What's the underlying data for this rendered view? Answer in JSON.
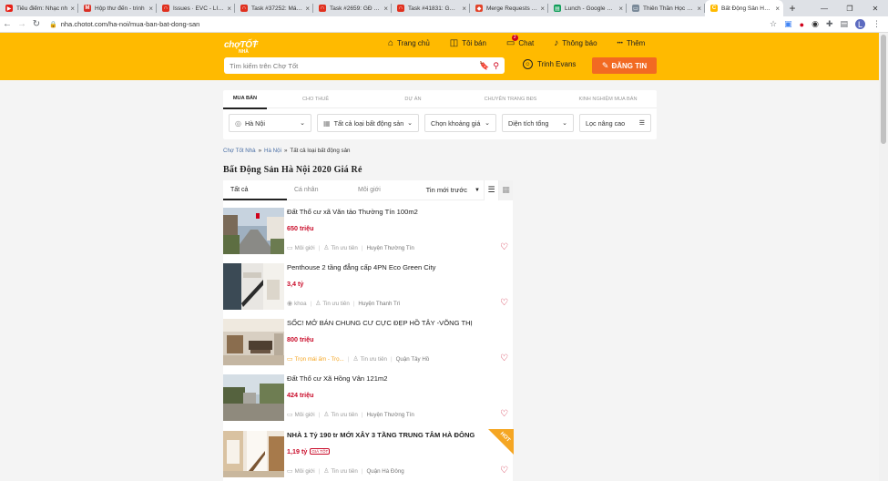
{
  "browser": {
    "tabs": [
      {
        "title": "Tiêu điểm: Nhạc nh",
        "icon_color": "#e62117",
        "icon": "youtube-icon"
      },
      {
        "title": "Hộp thư đến - trinh",
        "icon_color": "#d93025",
        "icon": "gmail-icon"
      },
      {
        "title": "Issues · EVC - LIFET",
        "icon_color": "#e0301e",
        "icon": "task-icon"
      },
      {
        "title": "Task #37252: Mái b",
        "icon_color": "#e0301e",
        "icon": "task-icon"
      },
      {
        "title": "Task #2659: GĐ - H",
        "icon_color": "#e0301e",
        "icon": "task-icon"
      },
      {
        "title": "Task #41831: GĐ - L",
        "icon_color": "#e0301e",
        "icon": "task-icon"
      },
      {
        "title": "Merge Requests · E",
        "icon_color": "#e24329",
        "icon": "gitlab-icon"
      },
      {
        "title": "Lunch - Google She",
        "icon_color": "#0f9d58",
        "icon": "sheets-icon"
      },
      {
        "title": "Thiên Thần Học Việ",
        "icon_color": "#7a8a99",
        "icon": "page-icon"
      },
      {
        "title": "Bất Động Sản Hà N",
        "icon_color": "#ffba00",
        "icon": "chotot-icon",
        "active": true
      }
    ],
    "url": "nha.chotot.com/ha-noi/mua-ban-bat-dong-san",
    "profile_initial": "L"
  },
  "header": {
    "logo_line1": "chợTỐT",
    "logo_line2": "NHÀ",
    "nav": [
      {
        "label": "Trang chủ",
        "icon": "home-icon"
      },
      {
        "label": "Tôi bán",
        "icon": "bag-icon"
      },
      {
        "label": "Chat",
        "icon": "chat-icon",
        "badge": "2"
      },
      {
        "label": "Thông báo",
        "icon": "bell-icon"
      },
      {
        "label": "Thêm",
        "icon": "more-icon"
      }
    ],
    "search_placeholder": "Tìm kiếm trên Chợ Tốt",
    "user_name": "Trinh Evans",
    "post_button": "ĐĂNG TIN"
  },
  "filter": {
    "tabs": [
      "MUA BÁN",
      "CHO THUÊ",
      "DỰ ÁN",
      "CHUYÊN TRANG BĐS",
      "KINH NGHIỆM MUA BÁN"
    ],
    "selects": [
      "Hà Nội",
      "Tất cả loại bất động sản",
      "Chọn khoảng giá",
      "Diện tích tổng",
      "Lọc nâng cao"
    ]
  },
  "breadcrumb": [
    "Chợ Tốt Nhà",
    "Hà Nội",
    "Tất cả loại bất động sản"
  ],
  "page_title": "Bất Động Sản Hà Nội 2020 Giá Rẻ",
  "listing": {
    "tabs": [
      "Tất cả",
      "Cá nhân",
      "Môi giới"
    ],
    "sort": "Tin mới trước",
    "items": [
      {
        "title": "Đất Thổ cư xã Văn tảo Thường Tín 100m2",
        "price": "650 triệu",
        "seller": "Môi giới",
        "badge": "Tin ưu tiên",
        "location": "Huyện Thường Tín"
      },
      {
        "title": "Penthouse 2 tầng đẳng cấp 4PN Eco Green City",
        "price": "3,4 tỷ",
        "seller": "khoa",
        "badge": "Tin ưu tiên",
        "location": "Huyện Thanh Trì"
      },
      {
        "title": "SỐC! MỞ BÁN CHUNG CƯ CỰC ĐẸP HỒ TÂY -VÕNG THỊ",
        "price": "800 triệu",
        "seller": "Trọn mái ấm - Trọ...",
        "badge": "Tin ưu tiên",
        "location": "Quận Tây Hồ"
      },
      {
        "title": "Đất Thổ cư Xã Hồng Vân 121m2",
        "price": "424 triệu",
        "seller": "Môi giới",
        "badge": "Tin ưu tiên",
        "location": "Huyện Thường Tín"
      },
      {
        "title": "NHÀ 1 Tỷ 190 tr MỚI XÂY 3 TẦNG TRUNG TÂM HÀ ĐÔNG",
        "price": "1,19 tỷ",
        "tag": "GIÁ TỐT",
        "seller": "Môi giới",
        "badge": "Tin ưu tiên",
        "location": "Quận Hà Đông",
        "hot": "HOT"
      }
    ]
  }
}
